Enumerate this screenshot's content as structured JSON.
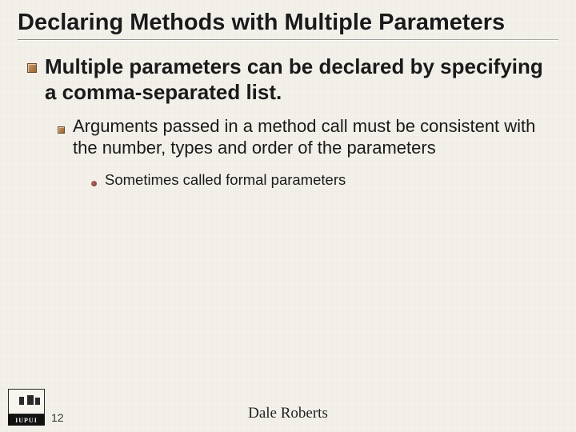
{
  "title": "Declaring Methods with Multiple Parameters",
  "bullets": {
    "lvl1": "Multiple parameters can be declared by specifying a comma-separated list.",
    "lvl2": "Arguments passed in a method call must be consistent with the number, types and order of the parameters",
    "lvl3": "Sometimes called formal parameters"
  },
  "footer": {
    "page_number": "12",
    "author": "Dale Roberts",
    "logo_text": "IUPUI"
  }
}
